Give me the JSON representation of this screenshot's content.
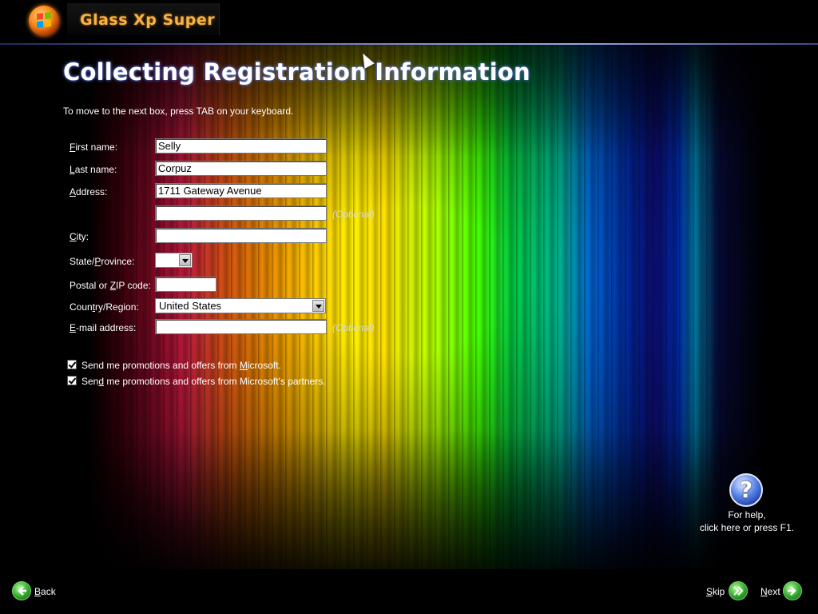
{
  "brand": {
    "title": "Glass Xp Super"
  },
  "page": {
    "title": "Collecting Registration Information",
    "instruction": "To move to the next box, press TAB on your keyboard."
  },
  "form": {
    "first_name": {
      "label_pre": "",
      "label_key": "F",
      "label_post": "irst name:",
      "value": "Selly"
    },
    "last_name": {
      "label_pre": "",
      "label_key": "L",
      "label_post": "ast name:",
      "value": "Corpuz"
    },
    "address": {
      "label_pre": "",
      "label_key": "A",
      "label_post": "ddress:",
      "value": "1711 Gateway Avenue"
    },
    "address2": {
      "value": "",
      "optional": "(Optional)"
    },
    "city": {
      "label_pre": "",
      "label_key": "C",
      "label_post": "ity:",
      "value": ""
    },
    "state": {
      "label_pre": "State/",
      "label_key": "P",
      "label_post": "rovince:",
      "value": ""
    },
    "zip": {
      "label_pre": "Postal or ",
      "label_key": "Z",
      "label_post": "IP code:",
      "value": ""
    },
    "country": {
      "label_pre": "Coun",
      "label_key": "t",
      "label_post": "ry/Region:",
      "value": "United States"
    },
    "email": {
      "label_pre": "",
      "label_key": "E",
      "label_post": "-mail address:",
      "value": "",
      "optional": "(Optional)"
    }
  },
  "checkboxes": {
    "promo_microsoft": {
      "label_pre": "Send me promotions and offers from ",
      "label_key": "M",
      "label_post": "icrosoft.",
      "checked": true
    },
    "promo_partners": {
      "label_pre": "Sen",
      "label_key": "d",
      "label_post": " me promotions and offers from Microsoft's partners.",
      "checked": true
    }
  },
  "help": {
    "line1": "For help,",
    "line2": "click here or press F1."
  },
  "nav": {
    "back": {
      "key": "B",
      "rest": "ack"
    },
    "skip": {
      "key": "S",
      "rest": "kip"
    },
    "next": {
      "key": "N",
      "rest": "ext"
    }
  },
  "colors": {
    "title_glow": "#6a8cff",
    "brand_text": "#f4b247",
    "nav_button": "#2ea82a",
    "help_button": "#5a86e8"
  },
  "icons": {
    "brand_orb": "windows-orb-icon",
    "help": "question-mark-icon",
    "back": "arrow-left-icon",
    "skip": "double-arrow-right-icon",
    "next": "arrow-right-icon"
  }
}
